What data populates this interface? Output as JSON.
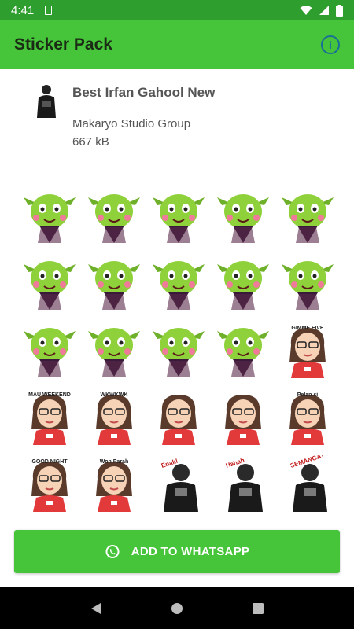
{
  "status_bar": {
    "time": "4:41"
  },
  "app_bar": {
    "title": "Sticker Pack"
  },
  "pack": {
    "name": "Best Irfan Gahool New",
    "publisher": "Makaryo Studio Group",
    "size": "667 kB"
  },
  "stickers": [
    {
      "kind": "goblin"
    },
    {
      "kind": "goblin"
    },
    {
      "kind": "goblin"
    },
    {
      "kind": "goblin"
    },
    {
      "kind": "goblin"
    },
    {
      "kind": "goblin"
    },
    {
      "kind": "goblin"
    },
    {
      "kind": "goblin"
    },
    {
      "kind": "goblin"
    },
    {
      "kind": "goblin"
    },
    {
      "kind": "goblin"
    },
    {
      "kind": "goblin"
    },
    {
      "kind": "goblin"
    },
    {
      "kind": "goblin"
    },
    {
      "kind": "girl",
      "text": "GIMME FIVE"
    },
    {
      "kind": "girl",
      "text": "MAU WEEKEND"
    },
    {
      "kind": "girl",
      "text": "WKWKWK"
    },
    {
      "kind": "girl"
    },
    {
      "kind": "girl"
    },
    {
      "kind": "girl",
      "text": "Pelan si"
    },
    {
      "kind": "girl",
      "text": "GOOD NIGHT"
    },
    {
      "kind": "girl",
      "text": "Woh Parah"
    },
    {
      "kind": "photo",
      "text": "Enak!"
    },
    {
      "kind": "photo",
      "text": "Hahah"
    },
    {
      "kind": "photo",
      "text": "SEMANGAT"
    }
  ],
  "add_button": {
    "label": "ADD TO WHATSAPP"
  },
  "colors": {
    "status": "#2e9e2e",
    "primary": "#46c43a",
    "goblin": "#8fd13a",
    "shirt": "#e23a3a"
  }
}
